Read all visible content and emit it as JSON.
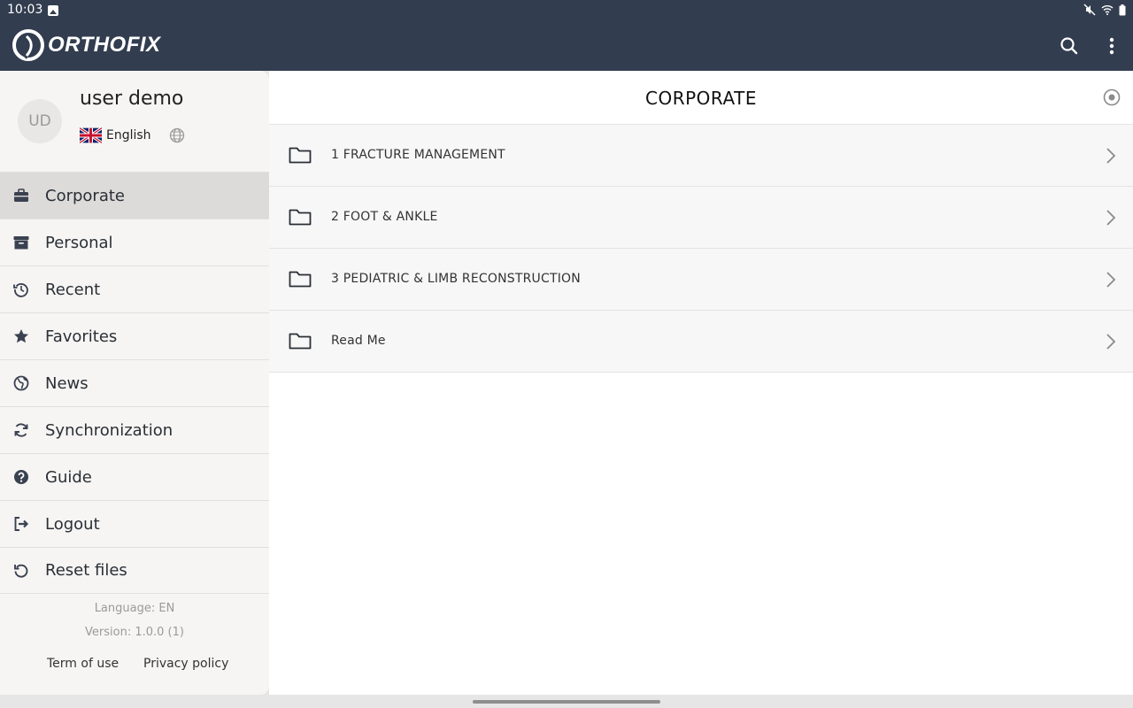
{
  "status_bar": {
    "time": "10:03"
  },
  "app_bar": {
    "logo_text": "ORTHOFIX"
  },
  "user": {
    "initials": "UD",
    "name": "user demo",
    "language": "English"
  },
  "sidebar": {
    "items": [
      {
        "label": "Corporate",
        "icon": "briefcase-icon",
        "active": true
      },
      {
        "label": "Personal",
        "icon": "archive-icon",
        "active": false
      },
      {
        "label": "Recent",
        "icon": "history-icon",
        "active": false
      },
      {
        "label": "Favorites",
        "icon": "star-icon",
        "active": false
      },
      {
        "label": "News",
        "icon": "globe-icon",
        "active": false
      },
      {
        "label": "Synchronization",
        "icon": "sync-icon",
        "active": false
      },
      {
        "label": "Guide",
        "icon": "help-icon",
        "active": false
      },
      {
        "label": "Logout",
        "icon": "logout-icon",
        "active": false
      },
      {
        "label": "Reset files",
        "icon": "reset-icon",
        "active": false
      }
    ],
    "footer": {
      "language": "Language: EN",
      "version": "Version: 1.0.0 (1)",
      "terms": "Term of use",
      "privacy": "Privacy policy"
    }
  },
  "main": {
    "title": "CORPORATE",
    "folders": [
      {
        "label": "1 FRACTURE MANAGEMENT"
      },
      {
        "label": "2 FOOT & ANKLE"
      },
      {
        "label": "3 PEDIATRIC & LIMB RECONSTRUCTION"
      },
      {
        "label": "Read Me"
      }
    ]
  },
  "colors": {
    "app_bar": "#323d4f",
    "sidebar_bg": "#f6f5f3",
    "active_item": "#dddbd9",
    "folder_row": "#f7f7f7"
  }
}
